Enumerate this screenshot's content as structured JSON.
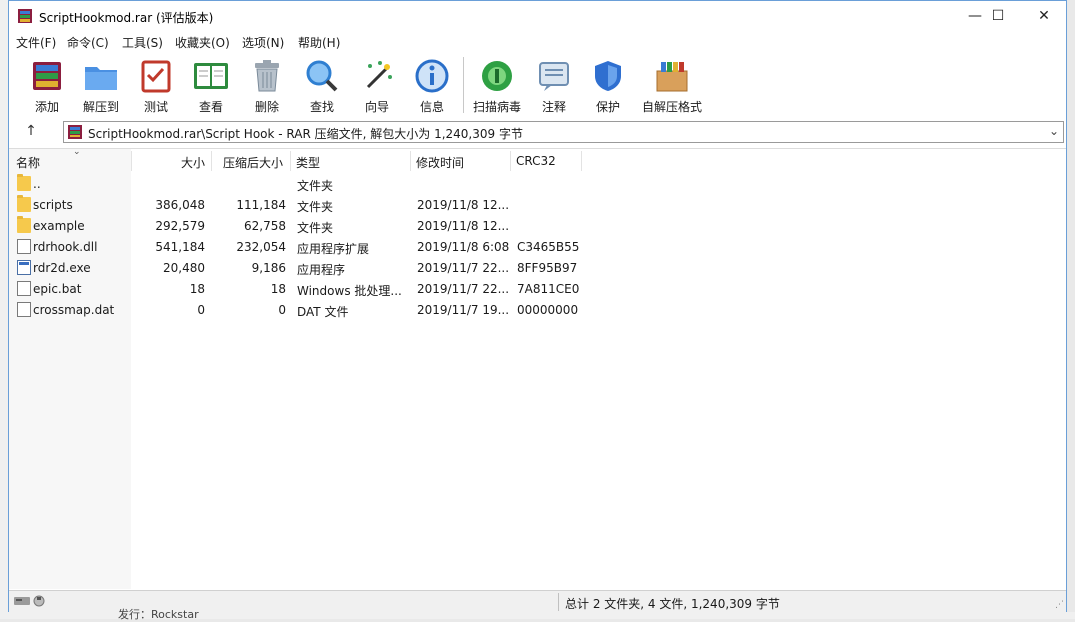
{
  "window": {
    "title": "ScriptHookmod.rar (评估版本)",
    "minimize": "—",
    "maximize": "☐",
    "close": "✕"
  },
  "menu": [
    "文件(F)",
    "命令(C)",
    "工具(S)",
    "收藏夹(O)",
    "选项(N)",
    "帮助(H)"
  ],
  "toolbar": [
    {
      "label": "添加",
      "icon": "add-archive-icon",
      "color": "#c0392b"
    },
    {
      "label": "解压到",
      "icon": "extract-folder-icon",
      "color": "#3d86d6"
    },
    {
      "label": "测试",
      "icon": "test-checklist-icon",
      "color": "#c0392b"
    },
    {
      "label": "查看",
      "icon": "view-book-icon",
      "color": "#2e8b3e"
    },
    {
      "label": "删除",
      "icon": "delete-trash-icon",
      "color": "#7a8a99"
    },
    {
      "label": "查找",
      "icon": "find-magnifier-icon",
      "color": "#2f7fd1"
    },
    {
      "label": "向导",
      "icon": "wizard-wand-icon",
      "color": "#3aa35a"
    },
    {
      "label": "信息",
      "icon": "info-icon",
      "color": "#2a6fc9"
    },
    {
      "label": "扫描病毒",
      "icon": "virus-scan-icon",
      "color": "#2ea043"
    },
    {
      "label": "注释",
      "icon": "comment-icon",
      "color": "#6f8fb2"
    },
    {
      "label": "保护",
      "icon": "protect-shield-icon",
      "color": "#2f6fd0"
    },
    {
      "label": "自解压格式",
      "icon": "sfx-box-icon",
      "color": "#c8863a"
    }
  ],
  "address": {
    "text": "ScriptHookmod.rar\\Script Hook - RAR 压缩文件, 解包大小为 1,240,309 字节"
  },
  "columns": {
    "name": "名称",
    "size": "大小",
    "packed": "压缩后大小",
    "type": "类型",
    "modified": "修改时间",
    "crc": "CRC32"
  },
  "files": [
    {
      "name": "..",
      "size": "",
      "packed": "",
      "type": "文件夹",
      "modified": "",
      "crc": "",
      "kind": "folder"
    },
    {
      "name": "scripts",
      "size": "386,048",
      "packed": "111,184",
      "type": "文件夹",
      "modified": "2019/11/8 12...",
      "crc": "",
      "kind": "folder"
    },
    {
      "name": "example",
      "size": "292,579",
      "packed": "62,758",
      "type": "文件夹",
      "modified": "2019/11/8 12...",
      "crc": "",
      "kind": "folder"
    },
    {
      "name": "rdrhook.dll",
      "size": "541,184",
      "packed": "232,054",
      "type": "应用程序扩展",
      "modified": "2019/11/8 6:08",
      "crc": "C3465B55",
      "kind": "doc"
    },
    {
      "name": "rdr2d.exe",
      "size": "20,480",
      "packed": "9,186",
      "type": "应用程序",
      "modified": "2019/11/7 22...",
      "crc": "8FF95B97",
      "kind": "exe"
    },
    {
      "name": "epic.bat",
      "size": "18",
      "packed": "18",
      "type": "Windows 批处理...",
      "modified": "2019/11/7 22...",
      "crc": "7A811CE0",
      "kind": "doc"
    },
    {
      "name": "crossmap.dat",
      "size": "0",
      "packed": "0",
      "type": "DAT 文件",
      "modified": "2019/11/7 19...",
      "crc": "00000000",
      "kind": "doc"
    }
  ],
  "status": {
    "text": "总计 2 文件夹, 4 文件, 1,240,309 字节"
  },
  "background": {
    "bottom_text": "发行：Rockstar"
  }
}
